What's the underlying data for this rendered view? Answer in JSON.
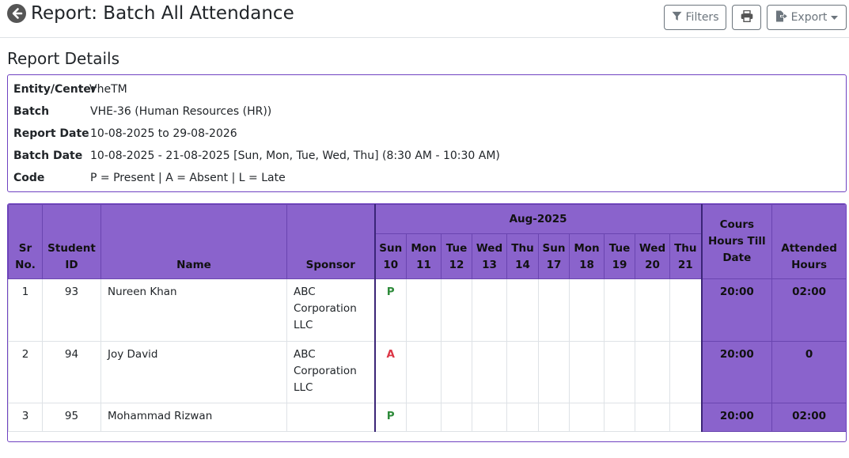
{
  "header": {
    "title": "Report: Batch All Attendance",
    "filters_label": "Filters",
    "export_label": "Export"
  },
  "details": {
    "section_title": "Report Details",
    "rows": [
      {
        "label": "Entity/Center",
        "value": "VheTM"
      },
      {
        "label": "Batch",
        "value": "VHE-36 (Human Resources (HR))"
      },
      {
        "label": "Report Date",
        "value": "10-08-2025 to 29-08-2026"
      },
      {
        "label": "Batch Date",
        "value": "10-08-2025 - 21-08-2025 [Sun, Mon, Tue, Wed, Thu] (8:30 AM - 10:30 AM)"
      },
      {
        "label": "Code",
        "value": "P = Present | A = Absent | L = Late"
      }
    ]
  },
  "table": {
    "headers": {
      "sr": [
        "Sr",
        "No."
      ],
      "student_id": [
        "Student",
        "ID"
      ],
      "name": "Name",
      "sponsor": "Sponsor",
      "month": "Aug-2025",
      "course_hours": [
        "Cours",
        "Hours Till",
        "Date"
      ],
      "attended": [
        "Attended",
        "Hours"
      ]
    },
    "days": [
      {
        "dow": "Sun",
        "d": "10"
      },
      {
        "dow": "Mon",
        "d": "11"
      },
      {
        "dow": "Tue",
        "d": "12"
      },
      {
        "dow": "Wed",
        "d": "13"
      },
      {
        "dow": "Thu",
        "d": "14"
      },
      {
        "dow": "Sun",
        "d": "17"
      },
      {
        "dow": "Mon",
        "d": "18"
      },
      {
        "dow": "Tue",
        "d": "19"
      },
      {
        "dow": "Wed",
        "d": "20"
      },
      {
        "dow": "Thu",
        "d": "21"
      }
    ],
    "rows": [
      {
        "sr": "1",
        "id": "93",
        "name": "Nureen Khan",
        "sponsor": [
          "ABC",
          "Corporation",
          "LLC"
        ],
        "attendance": [
          "P",
          "",
          "",
          "",
          "",
          "",
          "",
          "",
          "",
          ""
        ],
        "course_hours": "20:00",
        "attended": "02:00"
      },
      {
        "sr": "2",
        "id": "94",
        "name": "Joy David",
        "sponsor": [
          "ABC",
          "Corporation",
          "LLC"
        ],
        "attendance": [
          "A",
          "",
          "",
          "",
          "",
          "",
          "",
          "",
          "",
          ""
        ],
        "course_hours": "20:00",
        "attended": "0"
      },
      {
        "sr": "3",
        "id": "95",
        "name": "Mohammad Rizwan",
        "sponsor": [
          "",
          "",
          ""
        ],
        "attendance": [
          "P",
          "",
          "",
          "",
          "",
          "",
          "",
          "",
          "",
          ""
        ],
        "course_hours": "20:00",
        "attended": "02:00"
      }
    ]
  },
  "colors": {
    "accent": "#8a63cc",
    "border_accent": "#6f42c1",
    "present": "#2e8b3a",
    "absent": "#dc3545"
  },
  "icons": {
    "back": "arrow-left-circle-icon",
    "filter": "filter-icon",
    "print": "printer-icon",
    "export": "file-export-icon",
    "caret": "caret-down-icon"
  }
}
